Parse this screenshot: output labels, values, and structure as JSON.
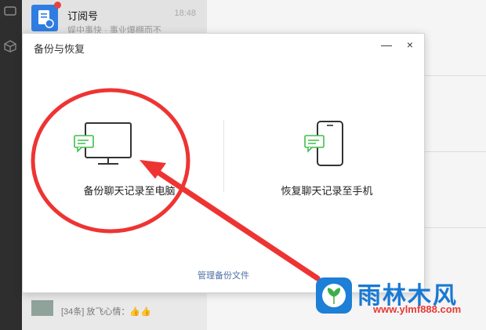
{
  "chat_list": {
    "item": {
      "title": "订阅号",
      "time": "18:48",
      "preview": "娱中事快 · 事业爆棚而不"
    },
    "bottom_text": "[34条] 放飞心情：👍👍"
  },
  "dialog": {
    "title": "备份与恢复",
    "minimize_glyph": "—",
    "close_glyph": "×",
    "option_backup_label": "备份聊天记录至电脑",
    "option_restore_label": "恢复聊天记录至手机",
    "manage_link": "管理备份文件"
  },
  "watermark": {
    "text": "雨林木风",
    "url": "www.ylmf888.com"
  },
  "colors": {
    "accent_green": "#3fbf4b",
    "annotation_red": "#ee3433",
    "brand_blue": "#1979d3"
  },
  "icons": [
    "monitor-icon",
    "phone-icon",
    "chat-bubble-icon",
    "bell-icon",
    "cube-icon",
    "chat-icon"
  ]
}
